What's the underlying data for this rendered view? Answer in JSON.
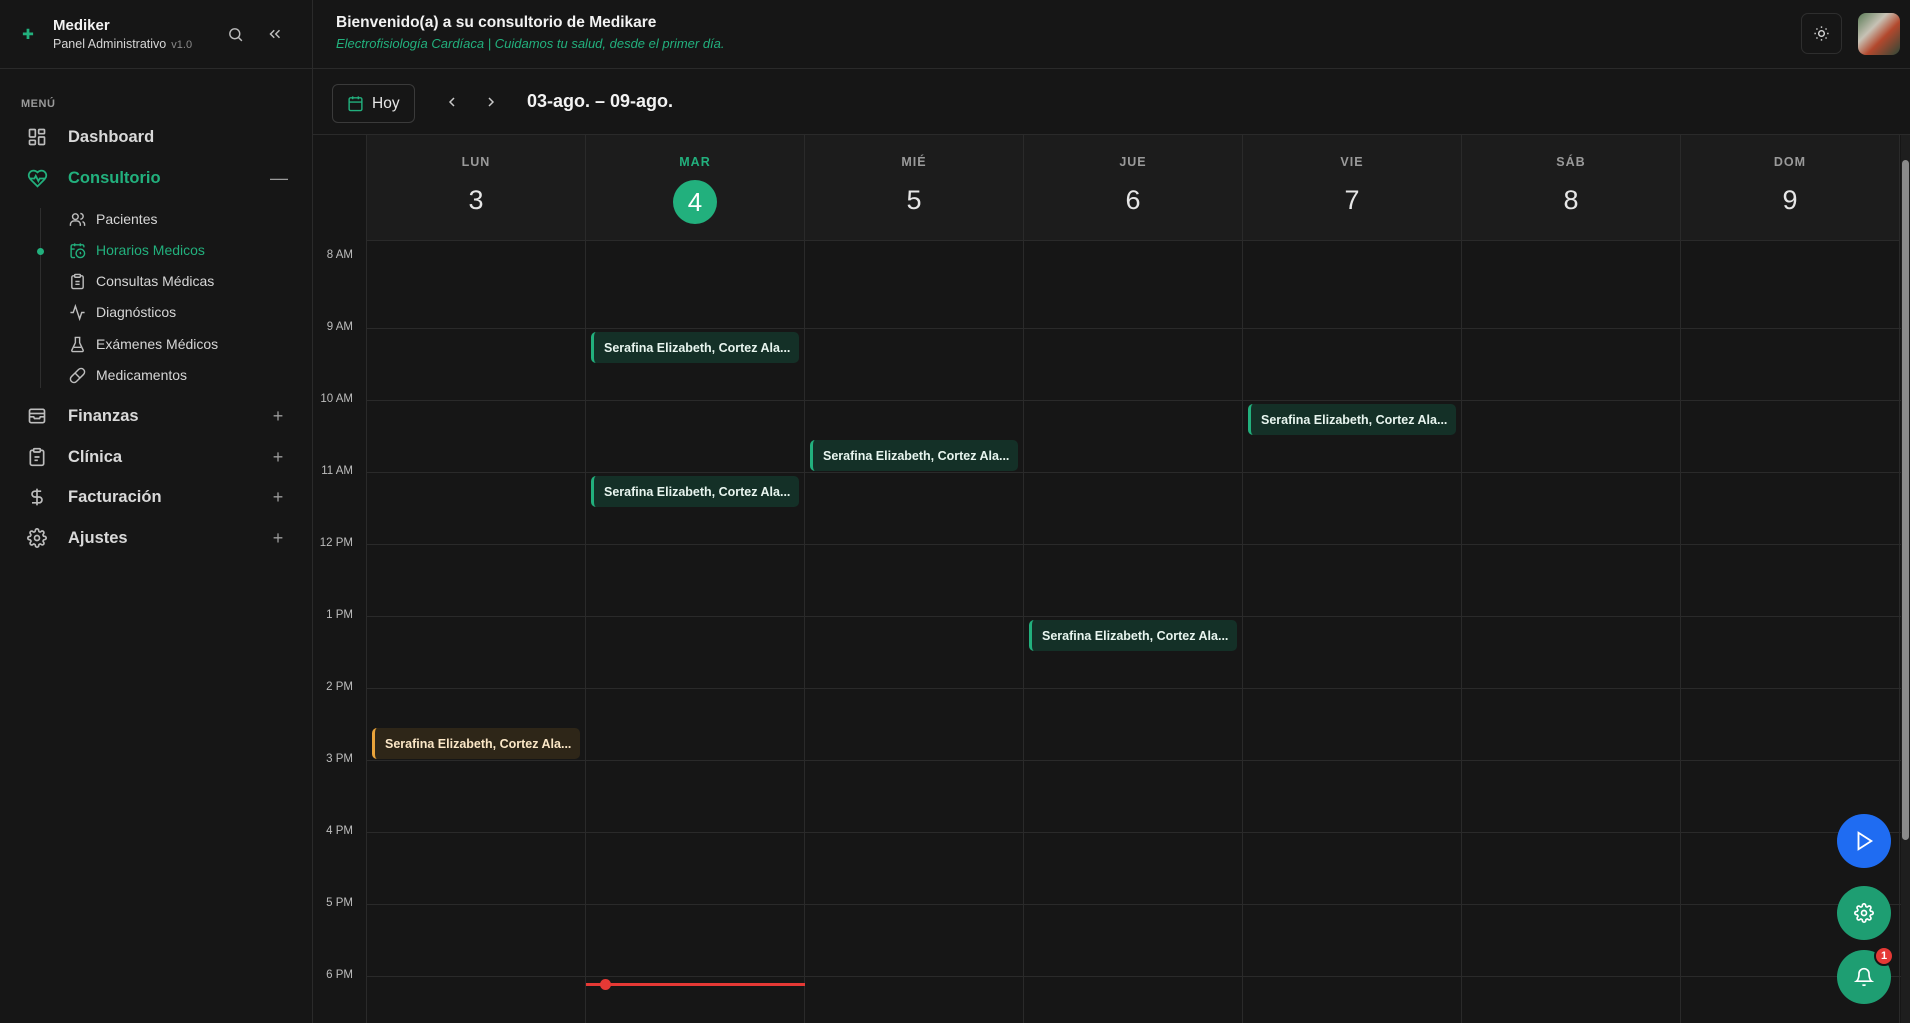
{
  "brand": {
    "name": "Mediker",
    "subtitle": "Panel Administrativo",
    "version": "v1.0"
  },
  "sidebar": {
    "menu_title": "MENÚ",
    "items": [
      {
        "label": "Dashboard",
        "icon": "dashboard-icon"
      },
      {
        "label": "Consultorio",
        "icon": "heart-pulse-icon",
        "toggle": "—",
        "active": true
      },
      {
        "label": "Finanzas",
        "icon": "wallet-icon",
        "toggle": "+"
      },
      {
        "label": "Clínica",
        "icon": "clipboard-icon",
        "toggle": "+"
      },
      {
        "label": "Facturación",
        "icon": "dollar-icon",
        "toggle": "+"
      },
      {
        "label": "Ajustes",
        "icon": "gear-icon",
        "toggle": "+"
      }
    ],
    "subitems": [
      {
        "label": "Pacientes",
        "icon": "users-icon"
      },
      {
        "label": "Horarios Medicos",
        "icon": "calendar-clock-icon",
        "active": true
      },
      {
        "label": "Consultas Médicas",
        "icon": "clipboard-list-icon"
      },
      {
        "label": "Diagnósticos",
        "icon": "activity-icon"
      },
      {
        "label": "Exámenes Médicos",
        "icon": "flask-icon"
      },
      {
        "label": "Medicamentos",
        "icon": "pill-icon"
      }
    ]
  },
  "header": {
    "welcome": "Bienvenido(a) a su consultorio de Medikare",
    "tagline": "Electrofisiología Cardíaca | Cuidamos tu salud, desde el primer día."
  },
  "toolbar": {
    "today_label": "Hoy",
    "range": "03-ago. – 09-ago."
  },
  "calendar": {
    "days": [
      {
        "name": "LUN",
        "num": "3"
      },
      {
        "name": "MAR",
        "num": "4",
        "today": true
      },
      {
        "name": "MIÉ",
        "num": "5"
      },
      {
        "name": "JUE",
        "num": "6"
      },
      {
        "name": "VIE",
        "num": "7"
      },
      {
        "name": "SÁB",
        "num": "8"
      },
      {
        "name": "DOM",
        "num": "9"
      }
    ],
    "hours": [
      "8 AM",
      "9 AM",
      "10 AM",
      "11 AM",
      "12 PM",
      "1 PM",
      "2 PM",
      "3 PM",
      "4 PM",
      "5 PM",
      "6 PM"
    ],
    "events": [
      {
        "title": "Serafina Elizabeth, Cortez Ala...",
        "day": 1,
        "start": "9:15",
        "color": "green"
      },
      {
        "title": "Serafina Elizabeth, Cortez Ala...",
        "day": 1,
        "start": "11:15",
        "color": "green"
      },
      {
        "title": "Serafina Elizabeth, Cortez Ala...",
        "day": 2,
        "start": "10:45",
        "color": "green"
      },
      {
        "title": "Serafina Elizabeth, Cortez Ala...",
        "day": 3,
        "start": "1:15 PM",
        "color": "green"
      },
      {
        "title": "Serafina Elizabeth, Cortez Ala...",
        "day": 4,
        "start": "10:15",
        "color": "green"
      },
      {
        "title": "Serafina Elizabeth, Cortez Ala...",
        "day": 0,
        "start": "2:45 PM",
        "color": "orange"
      }
    ]
  },
  "notifications": {
    "count": "1"
  },
  "colors": {
    "accent": "#22b07d",
    "now_line": "#e53935",
    "fab_blue": "#1f6cf2",
    "event_orange": "#e9a33a"
  }
}
